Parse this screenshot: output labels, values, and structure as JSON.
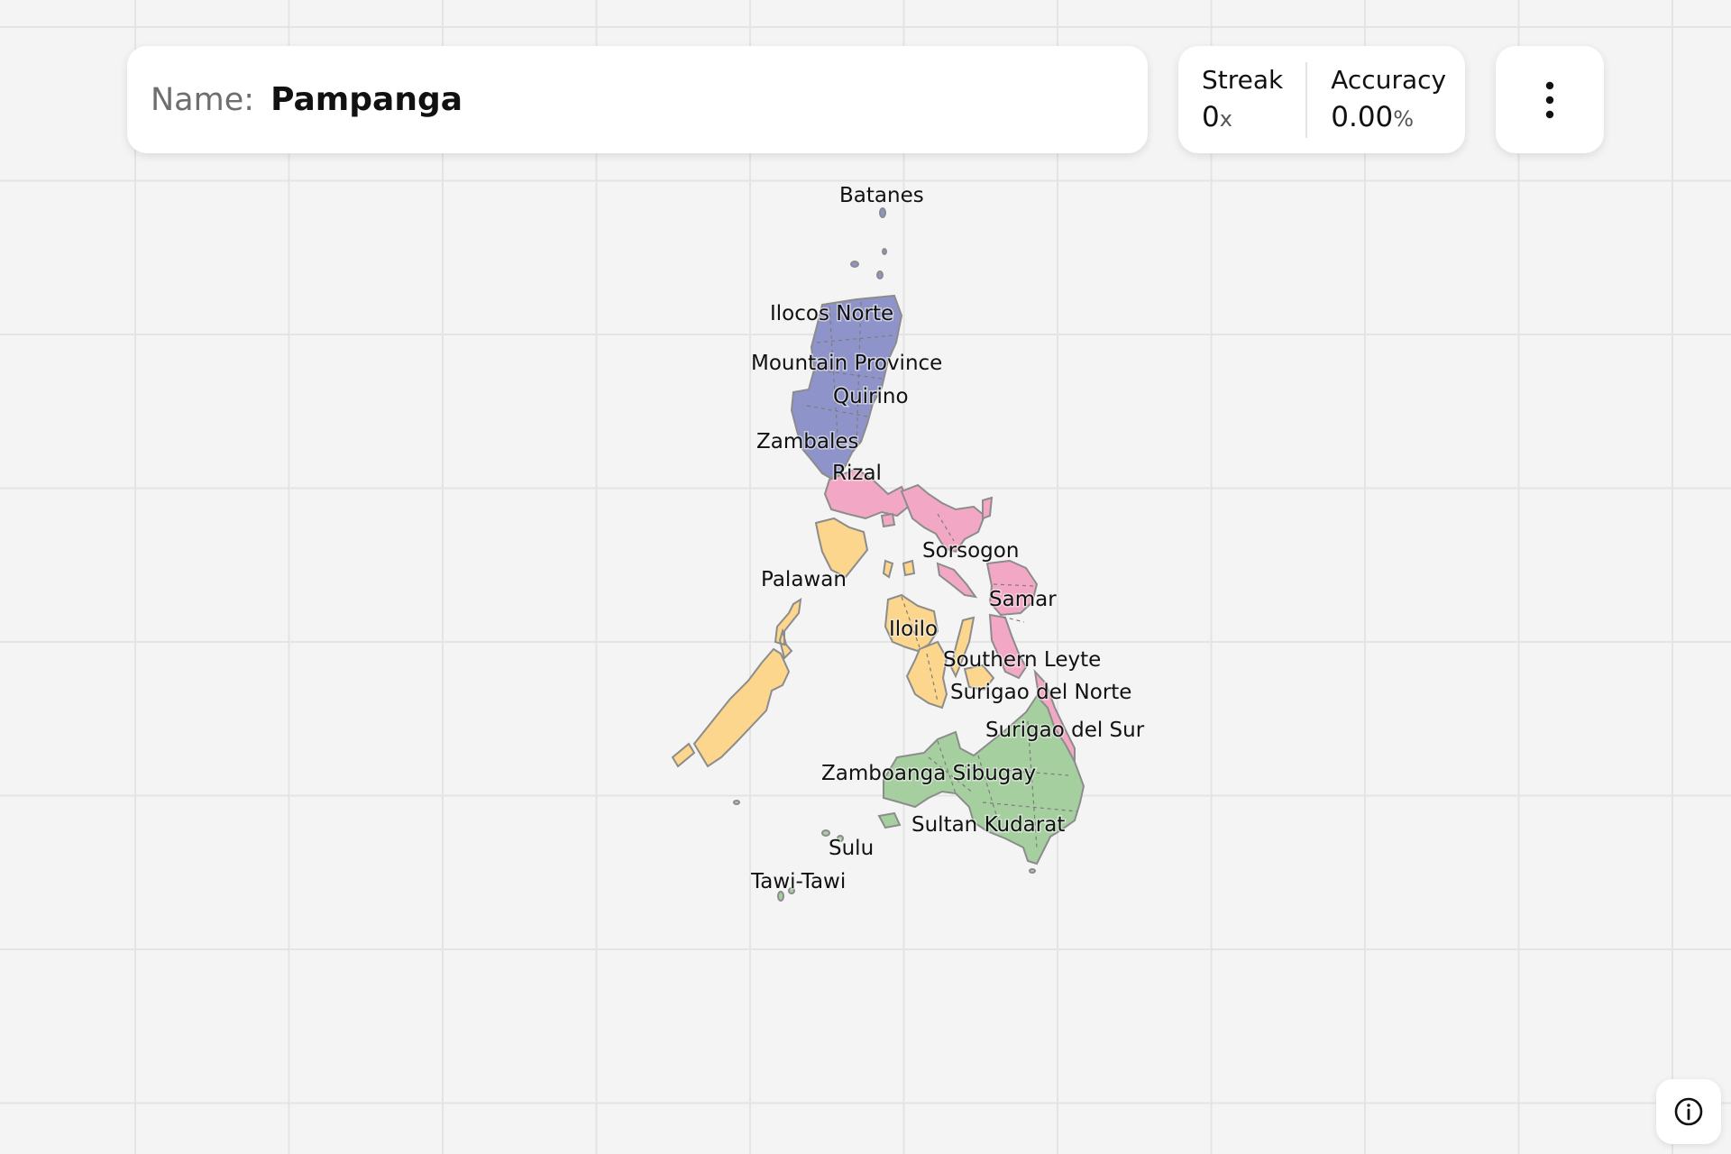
{
  "header": {
    "name_label": "Name:",
    "name_value": "Pampanga"
  },
  "stats": {
    "streak_label": "Streak",
    "streak_value": "0",
    "streak_unit": "x",
    "accuracy_label": "Accuracy",
    "accuracy_value": "0.00",
    "accuracy_unit": "%"
  },
  "icons": {
    "menu": "more-vertical-icon",
    "info": "info-icon"
  },
  "colors": {
    "luzon": "#8e94c9",
    "bicol_visayas_east": "#f2a8c4",
    "west_visayas_palawan": "#fbd68c",
    "mindanao": "#a6cfa0"
  },
  "map_labels": {
    "batanes": "Batanes",
    "ilocos_norte": "Ilocos Norte",
    "mountain_province": "Mountain Province",
    "quirino": "Quirino",
    "zambales": "Zambales",
    "rizal": "Rizal",
    "sorsogon": "Sorsogon",
    "palawan": "Palawan",
    "samar": "Samar",
    "iloilo": "Iloilo",
    "southern_leyte": "Southern Leyte",
    "surigao_del_norte": "Surigao del Norte",
    "surigao_del_sur": "Surigao del Sur",
    "zamboanga_sibugay": "Zamboanga Sibugay",
    "sultan_kudarat": "Sultan Kudarat",
    "sulu": "Sulu",
    "tawi_tawi": "Tawi-Tawi"
  }
}
